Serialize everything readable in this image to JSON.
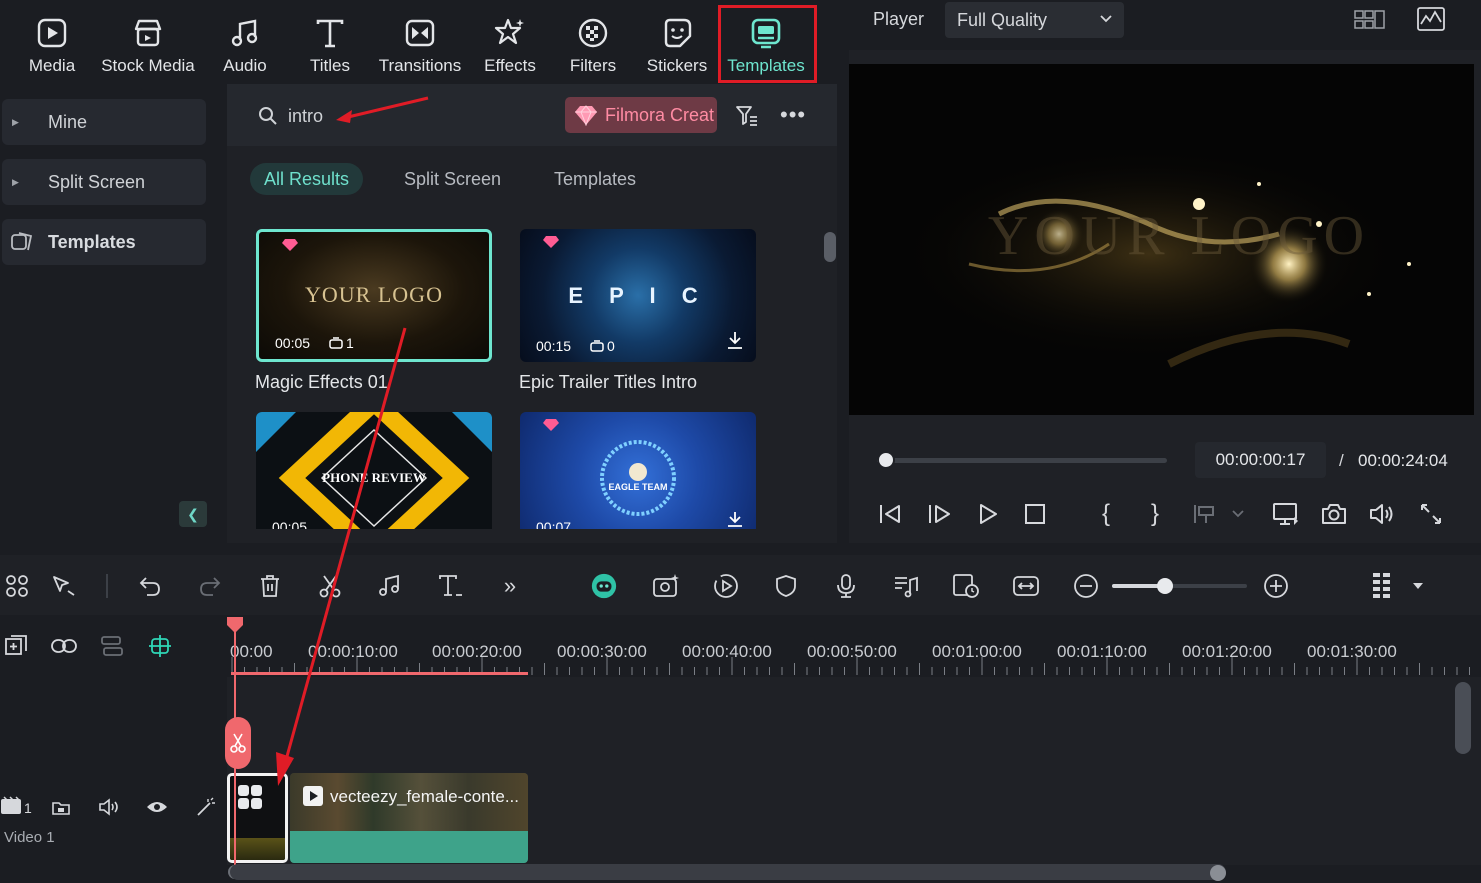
{
  "toolbar": {
    "items": [
      {
        "label": "Media",
        "icon": "media-icon"
      },
      {
        "label": "Stock Media",
        "icon": "stock-media-icon"
      },
      {
        "label": "Audio",
        "icon": "audio-note-icon"
      },
      {
        "label": "Titles",
        "icon": "titles-t-icon"
      },
      {
        "label": "Transitions",
        "icon": "transitions-icon"
      },
      {
        "label": "Effects",
        "icon": "effects-star-icon"
      },
      {
        "label": "Filters",
        "icon": "filters-icon"
      },
      {
        "label": "Stickers",
        "icon": "stickers-icon"
      },
      {
        "label": "Templates",
        "icon": "templates-icon"
      }
    ],
    "active": "Templates"
  },
  "sidebar": {
    "items": [
      {
        "label": "Mine"
      },
      {
        "label": "Split Screen"
      },
      {
        "label": "Templates"
      }
    ]
  },
  "search": {
    "value": "intro"
  },
  "promo": {
    "label": "Filmora Creat"
  },
  "tabs": [
    {
      "label": "All Results"
    },
    {
      "label": "Split Screen"
    },
    {
      "label": "Templates"
    }
  ],
  "cards": [
    {
      "title": "Magic Effects 01",
      "duration": "00:05",
      "count": "1",
      "thumb_text": "YOUR LOGO"
    },
    {
      "title": "Epic Trailer Titles Intro",
      "duration": "00:15",
      "count": "0",
      "thumb_text": "E P I C"
    },
    {
      "title": "",
      "duration": "00:05",
      "count": "",
      "thumb_text": "PHONE REVIEW"
    },
    {
      "title": "",
      "duration": "00:07",
      "count": "",
      "thumb_text": "EAGLE TEAM"
    }
  ],
  "player": {
    "label": "Player",
    "quality": "Full Quality",
    "current_time": "00:00:00:17",
    "separator": "/",
    "total_time": "00:00:24:04",
    "video_text": "YOUR LOGO",
    "progress": 0.03
  },
  "timeline": {
    "ticks": [
      "00:00",
      "00:00:10:00",
      "00:00:20:00",
      "00:00:30:00",
      "00:00:40:00",
      "00:00:50:00",
      "00:01:00:00",
      "00:01:10:00",
      "00:01:20:00",
      "00:01:30:00"
    ],
    "track_label": "Video 1",
    "track_number": "1",
    "clip_name": "vecteezy_female-conte..."
  },
  "colors": {
    "accent": "#6ee6cf",
    "highlight_box": "#e01c26",
    "playhead": "#f0686d",
    "annotation_arrow": "#e01c26",
    "clip_green": "#3ea38a"
  }
}
